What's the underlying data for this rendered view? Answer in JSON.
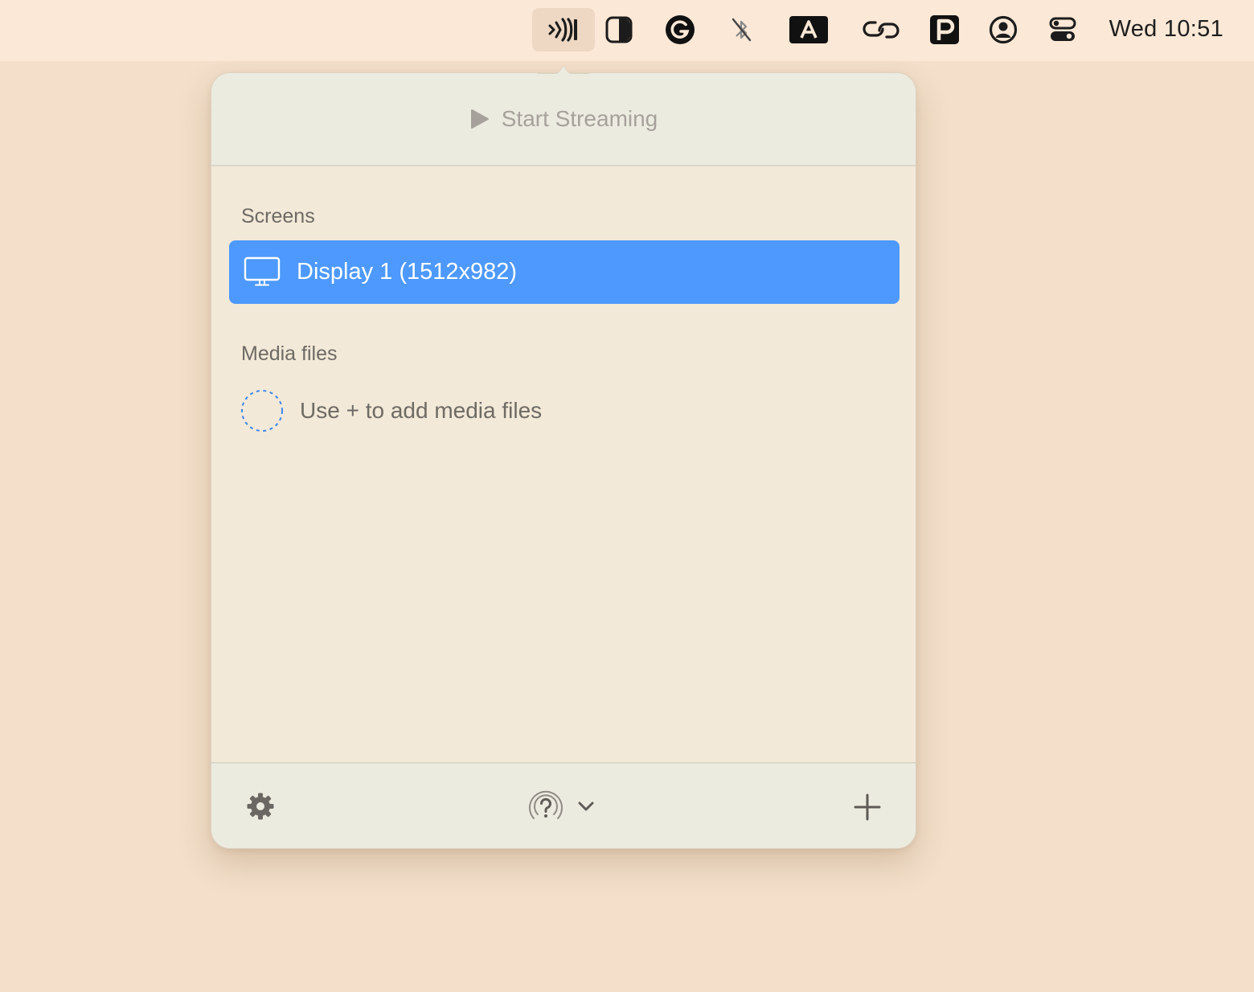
{
  "menubar": {
    "items": [
      {
        "icon": "streaming-app-icon",
        "active": true
      },
      {
        "icon": "contrast-icon"
      },
      {
        "icon": "grammarly-icon"
      },
      {
        "icon": "bluetooth-off-icon"
      },
      {
        "icon": "input-source-icon",
        "text": "A"
      },
      {
        "icon": "link-icon"
      },
      {
        "icon": "p-app-icon"
      },
      {
        "icon": "user-account-icon"
      },
      {
        "icon": "control-center-icon"
      }
    ],
    "clock": "Wed 10:51"
  },
  "popover": {
    "start_streaming": "Start Streaming",
    "screens_label": "Screens",
    "screens": [
      {
        "label": "Display 1 (1512x982)",
        "selected": true,
        "icon": "monitor-icon"
      }
    ],
    "media_label": "Media files",
    "media_empty": "Use + to add media files",
    "footer": {
      "settings_icon": "gear-icon",
      "device_icon": "airplay-question-icon",
      "device_chevron": "chevron-down-icon",
      "add_icon": "plus-icon"
    }
  },
  "colors": {
    "accent": "#4d99fd",
    "desktop": "#f3dfca",
    "menubar": "#fbe8d6",
    "popover_body": "#f2e9d8",
    "popover_bars": "#ecebe0"
  }
}
